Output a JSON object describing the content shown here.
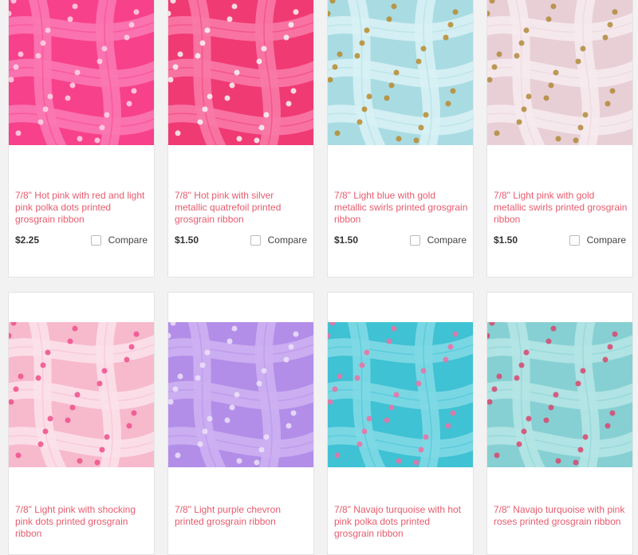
{
  "products": [
    {
      "title": "7/8\" Hot pink with red and light pink polka dots printed grosgrain ribbon",
      "price": "$2.25",
      "compare_label": "Compare",
      "image": "hot-pink-polka-dot-ribbon",
      "colors": {
        "bg": "#f7418a",
        "band": "#f978b2",
        "accent": "#ffd6e6"
      }
    },
    {
      "title": "7/8\" Hot pink with silver metallic quatrefoil printed grosgrain ribbon",
      "price": "$1.50",
      "compare_label": "Compare",
      "image": "hot-pink-quatrefoil-ribbon",
      "colors": {
        "bg": "#f03a74",
        "band": "#f87aa6",
        "accent": "#f7f7f7"
      }
    },
    {
      "title": "7/8\" Light blue with gold metallic swirls printed grosgrain ribbon",
      "price": "$1.50",
      "compare_label": "Compare",
      "image": "light-blue-gold-swirl-ribbon",
      "colors": {
        "bg": "#a9dbe3",
        "band": "#d7f1f4",
        "accent": "#b98a2c"
      }
    },
    {
      "title": "7/8\" Light pink with gold metallic swirls printed grosgrain ribbon",
      "price": "$1.50",
      "compare_label": "Compare",
      "image": "light-pink-gold-swirl-ribbon",
      "colors": {
        "bg": "#e8cfd6",
        "band": "#f6eaee",
        "accent": "#b08a3a"
      }
    },
    {
      "title": "7/8\" Light pink with shocking pink dots printed grosgrain ribbon",
      "image": "light-pink-shocking-dot-ribbon",
      "colors": {
        "bg": "#f7b9cc",
        "band": "#fbe1ea",
        "accent": "#ef4f8c"
      }
    },
    {
      "title": "7/8\" Light purple chevron printed grosgrain ribbon",
      "image": "light-purple-chevron-ribbon",
      "colors": {
        "bg": "#b38ee8",
        "band": "#cdb0f2",
        "accent": "#ece2fb"
      }
    },
    {
      "title": "7/8\" Navajo turquoise with hot pink polka dots printed grosgrain ribbon",
      "image": "turquoise-pink-dot-ribbon",
      "colors": {
        "bg": "#3fc2d3",
        "band": "#7fd9e4",
        "accent": "#f06fa4"
      }
    },
    {
      "title": "7/8\" Navajo turquoise with pink roses printed grosgrain ribbon",
      "image": "turquoise-pink-roses-ribbon",
      "colors": {
        "bg": "#86d0d3",
        "band": "#b5e4e4",
        "accent": "#d9456d"
      }
    }
  ]
}
